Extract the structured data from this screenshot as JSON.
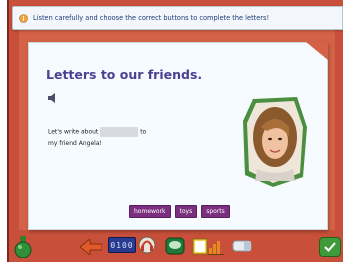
{
  "instruction": {
    "text": "Listen carefully and choose the correct buttons to complete the letters!",
    "icon": "info-icon"
  },
  "card": {
    "title": "Letters to our friends.",
    "speaker_icon": "speaker-icon",
    "sentence_part1": "Let's write about",
    "sentence_part2": "to",
    "sentence_line2": "my friend Angela!",
    "photo": "girl-portrait-image"
  },
  "choices": [
    {
      "label": "homework"
    },
    {
      "label": "toys"
    },
    {
      "label": "sports"
    }
  ],
  "toolbar": {
    "counter": "0100",
    "icons": [
      "potion-icon",
      "back-arrow-icon",
      "counter-display",
      "headphones-icon",
      "chat-icon",
      "book-icon",
      "chart-icon",
      "eraser-icon",
      "check-icon"
    ]
  },
  "colors": {
    "frame": "#c8503a",
    "title": "#4d3f92",
    "choice_button": "#7b2f7f",
    "banner_text": "#1d3a78"
  }
}
